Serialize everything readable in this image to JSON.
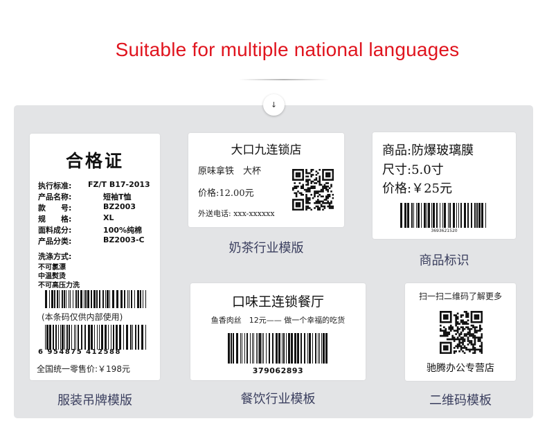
{
  "header": {
    "title": "Suitable for multiple national languages",
    "scroll_icon": "arrow-down-icon",
    "scroll_glyph": "↓"
  },
  "labels": {
    "garment": {
      "title": "合格证",
      "specs": [
        {
          "key": "执行标准:",
          "value": "FZ/T B17-2013"
        },
        {
          "key": "产品名称:",
          "value": "短袖T恤"
        },
        {
          "key": "款　　号:",
          "value": "BZ2003"
        },
        {
          "key": "规　　格:",
          "value": "XL"
        },
        {
          "key": "面料成分:",
          "value": "100%纯棉"
        },
        {
          "key": "产品分类:",
          "value": "BZ2003-C"
        }
      ],
      "wash_heading": "洗涤方式:",
      "wash_items": [
        "不可氯漂",
        "中温熨烫",
        "不可高压力洗"
      ],
      "internal_note": "(本条码仅供内部使用)",
      "barcode_number": "6 954875 412588",
      "price_text": "全国统一零售价:￥198元",
      "caption": "服装吊牌模版"
    },
    "milk_tea": {
      "store": "大口九连锁店",
      "product": "原味拿铁　大杯",
      "price": "价格:12.00元",
      "delivery": "外送电话: xxx-xxxxxx",
      "caption": "奶茶行业模版"
    },
    "product_id": {
      "line1": "商品:防爆玻璃膜",
      "line2": "尺寸:5.0寸",
      "line3": "价格:￥25元",
      "barcode_number": "3693621520",
      "caption": "商品标识"
    },
    "restaurant": {
      "store": "口味王连锁餐厅",
      "item": "鱼香肉丝　12元—— 做一个幸福的吃货",
      "barcode_number": "379062893",
      "caption": "餐饮行业模板"
    },
    "qr": {
      "prompt": "扫一扫二维码了解更多",
      "store": "驰腾办公专营店",
      "caption": "二维码模板"
    }
  },
  "colors": {
    "title_red": "#e0141e",
    "panel_gray": "#e3e4e6",
    "caption_navy": "#3a3e5e"
  }
}
